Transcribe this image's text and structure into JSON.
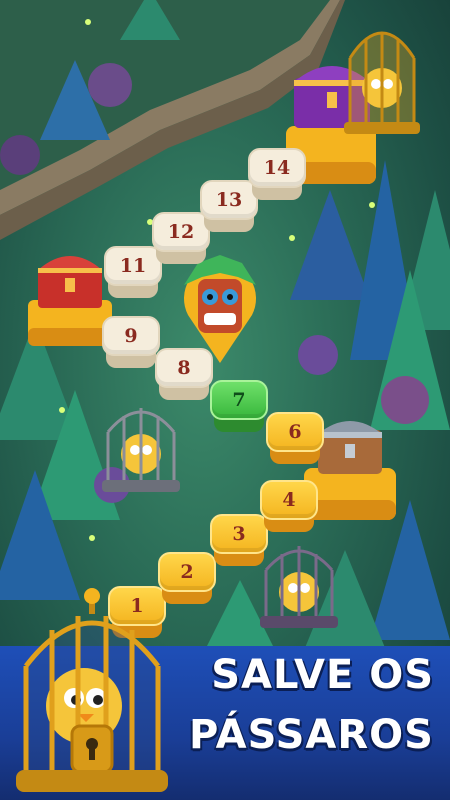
{
  "level_map": {
    "levels": [
      {
        "label": "1",
        "state": "gold"
      },
      {
        "label": "2",
        "state": "gold"
      },
      {
        "label": "3",
        "state": "gold"
      },
      {
        "label": "4",
        "state": "gold"
      },
      {
        "label": "6",
        "state": "gold"
      },
      {
        "label": "7",
        "state": "current"
      },
      {
        "label": "8",
        "state": "done"
      },
      {
        "label": "9",
        "state": "done"
      },
      {
        "label": "11",
        "state": "done"
      },
      {
        "label": "12",
        "state": "done"
      },
      {
        "label": "13",
        "state": "done"
      },
      {
        "label": "14",
        "state": "done"
      }
    ],
    "icons": {
      "treasure_chest_red": "treasure-chest-icon",
      "treasure_chest_purple": "treasure-chest-icon",
      "treasure_chest_silver": "treasure-chest-icon",
      "caged_bird": "bird-cage-icon",
      "tiki_mask": "tiki-mask-icon"
    }
  },
  "banner": {
    "line1": "SALVE OS",
    "line2": "PÁSSAROS"
  },
  "colors": {
    "banner_blue": "#1e4fb8",
    "tile_gold": "#f4b41f",
    "tile_current": "#38b73c",
    "tile_done": "#f5eddc",
    "number_text": "#8a2a1f"
  }
}
